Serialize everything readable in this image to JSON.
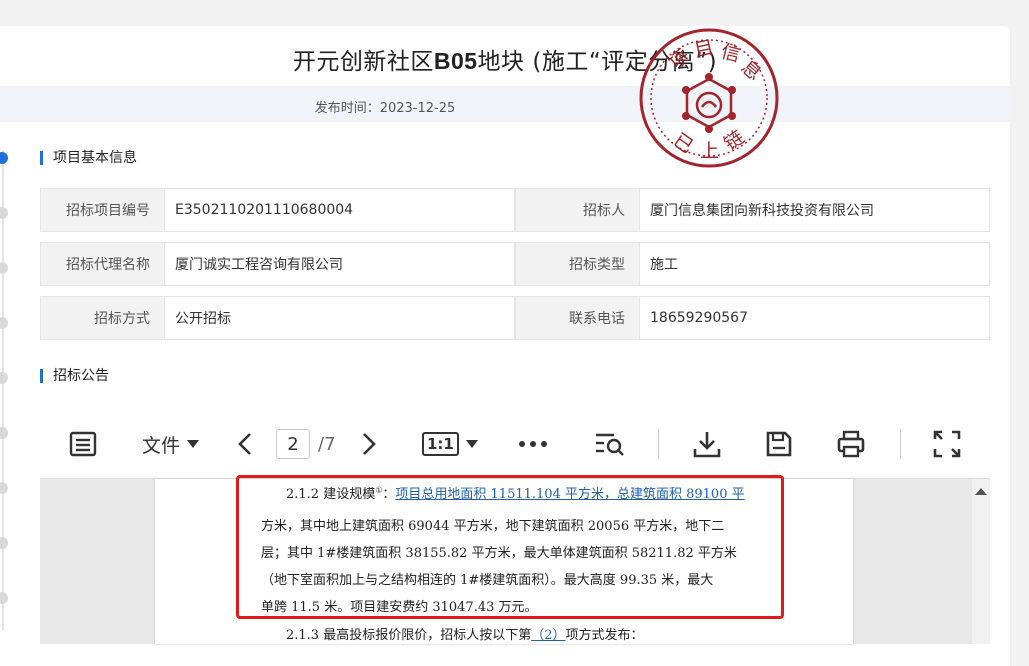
{
  "header": {
    "title_prefix": "开元创新社区",
    "title_code": "B05",
    "title_suffix": "地块 (施工“评定分离”)",
    "publish_label": "发布时间：",
    "publish_date": "2023-12-25"
  },
  "stamp": {
    "top_text": "项目信息",
    "bottom_text": "已上链",
    "color": "#a5232a"
  },
  "sections": {
    "basic_info": "项目基本信息",
    "announcement": "招标公告"
  },
  "info_rows": [
    {
      "l1": "招标项目编号",
      "v1": "E3502110201110680004",
      "l2": "招标人",
      "v2": "厦门信息集团向新科技投资有限公司"
    },
    {
      "l1": "招标代理名称",
      "v1": "厦门诚实工程咨询有限公司",
      "l2": "招标类型",
      "v2": "施工"
    },
    {
      "l1": "招标方式",
      "v1": "公开招标",
      "l2": "联系电话",
      "v2": "18659290567"
    }
  ],
  "viewer": {
    "file_menu": "文件",
    "current_page": "2",
    "total_pages": "/7",
    "zoom_label": "1:1",
    "icons": [
      "outline-icon",
      "chevron-left-icon",
      "chevron-right-icon",
      "more-icon",
      "search-text-icon",
      "download-icon",
      "save-icon",
      "print-icon",
      "fullscreen-icon"
    ]
  },
  "document": {
    "line1_prefix": "2.1.2 建设规模",
    "line1_sup": "①",
    "line1_colon": "：",
    "line1_link": "项目总用地面积 11511.104 平方米，总建筑面积 89100  平",
    "line2": "方米，其中地上建筑面积 69044 平方米，地下建筑面积  20056  平方米，地下二",
    "line3": "层；其中 1#楼建筑面积 38155.82 平方米，最大单体建筑面积 58211.82  平方米",
    "line4": "（地下室面积加上与之结构相连的 1#楼建筑面积）。最大高度 99.35  米，最大",
    "line5": "单跨 11.5 米。项目建安费约  31047.43  万元。",
    "line6_prefix": "2.1.3 最高投标报价限价，招标人按以下第",
    "line6_link": "（2）",
    "line6_suffix": "项方式发布："
  },
  "colors": {
    "accent": "#1f6fe0",
    "highlight_border": "#e01a1a",
    "link": "#1f5fb4"
  }
}
